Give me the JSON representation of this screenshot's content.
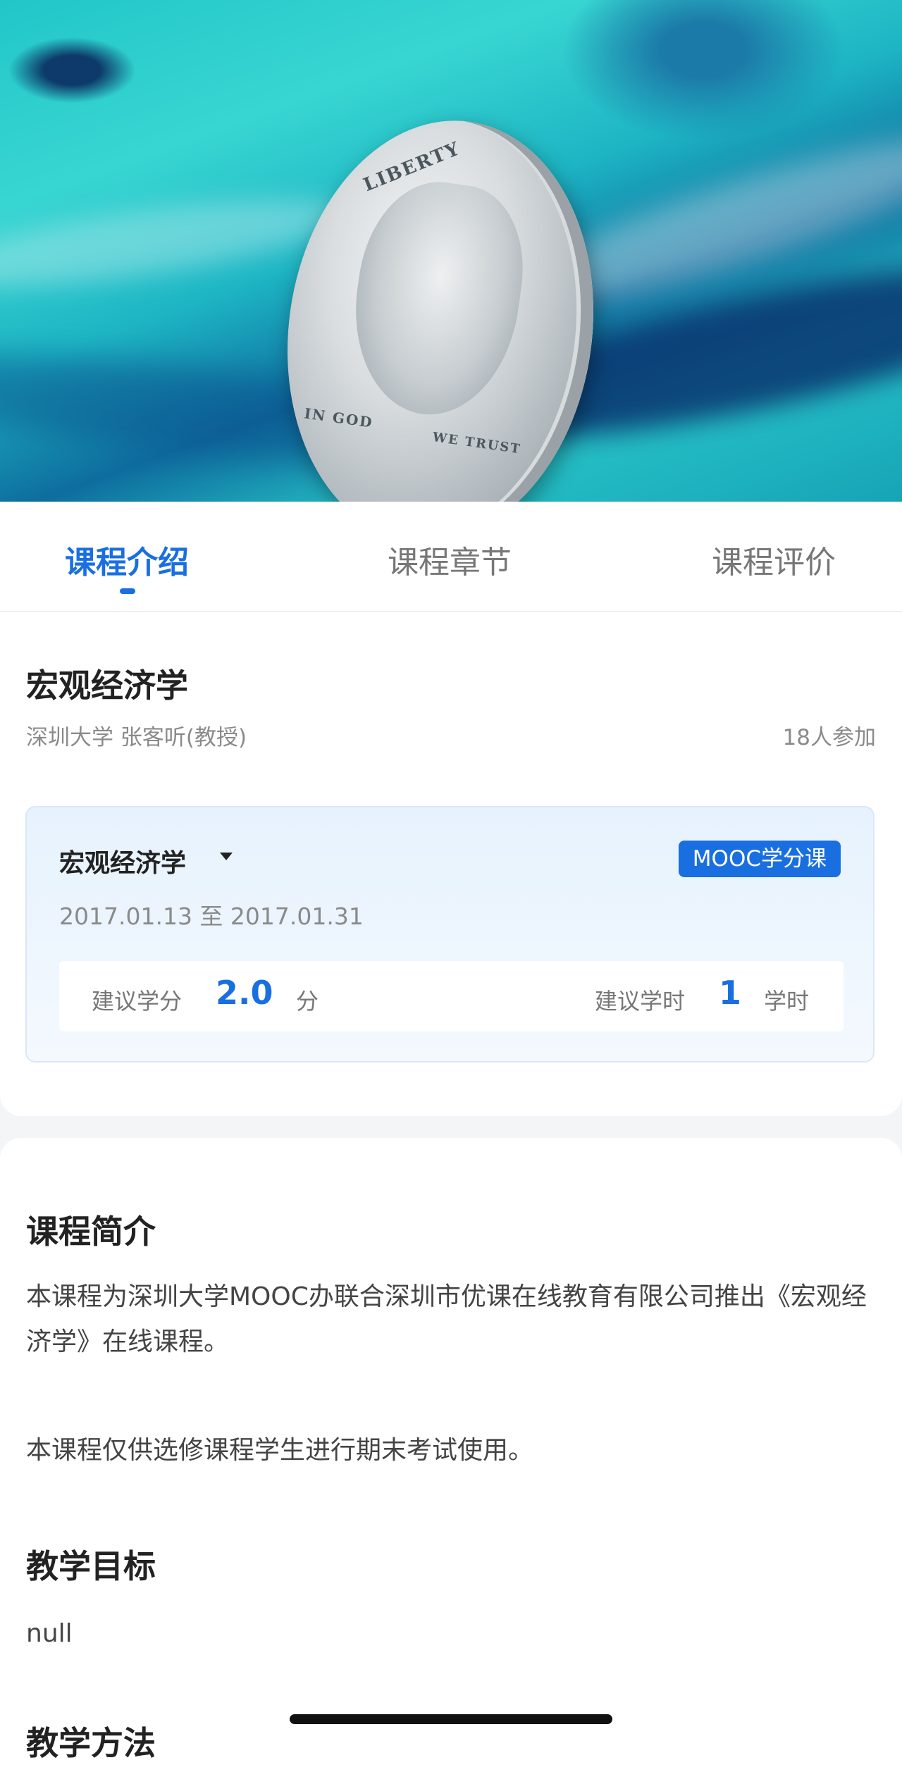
{
  "hero": {
    "image": "kennedy-half-dollar-coin-photo",
    "coin_text": {
      "liberty": "LIBERTY",
      "motto": "IN GOD",
      "motto2": "WE TRUST"
    }
  },
  "tabs": [
    {
      "label": "课程介绍",
      "active": true
    },
    {
      "label": "课程章节",
      "active": false
    },
    {
      "label": "课程评价",
      "active": false
    }
  ],
  "course": {
    "title": "宏观经济学",
    "meta": "深圳大学 张客听(教授)",
    "participants": "18人参加"
  },
  "term": {
    "name": "宏观经济学",
    "badge": "MOOC学分课",
    "dates": "2017.01.13 至 2017.01.31",
    "credit_label": "建议学分",
    "credit_value": "2.0",
    "credit_unit": "分",
    "hours_label": "建议学时",
    "hours_value": "1",
    "hours_unit": "学时"
  },
  "intro": {
    "title": "课程简介",
    "para1": "本课程为深圳大学MOOC办联合深圳市优课在线教育有限公司推出《宏观经济学》在线课程。",
    "para2": "本课程仅供选修课程学生进行期末考试使用。",
    "goals_title": "教学目标",
    "goals_text": "null",
    "method_title": "教学方法"
  },
  "colors": {
    "accent": "#1a6fe0",
    "muted": "#8a8a8a"
  }
}
